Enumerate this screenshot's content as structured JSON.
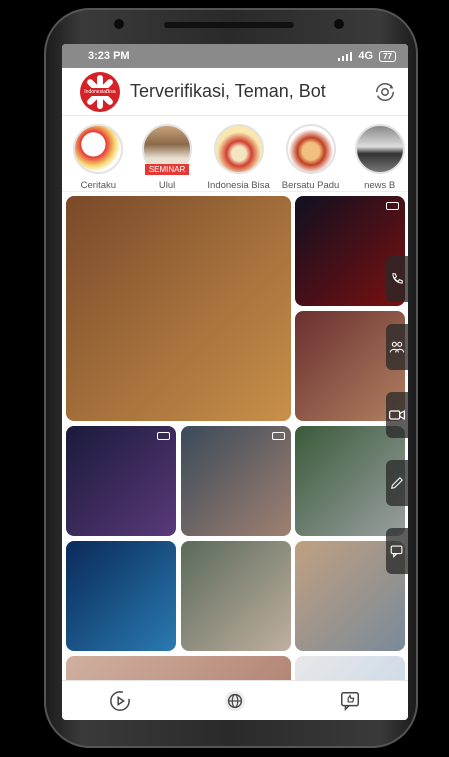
{
  "status": {
    "time": "3:23 PM",
    "network": "4G",
    "battery": "77"
  },
  "header": {
    "logo_text": "IndonesiaBisa",
    "title": "Terverifikasi, Teman, Bot"
  },
  "stories": [
    {
      "label": "Ceritaku",
      "tag": ""
    },
    {
      "label": "Ulul",
      "tag": "SEMINAR"
    },
    {
      "label": "Indonesia Bisa",
      "tag": ""
    },
    {
      "label": "Bersatu Padu",
      "tag": ""
    },
    {
      "label": "news B",
      "tag": ""
    }
  ],
  "tiles": [
    {
      "name": "market-tile",
      "colors": [
        "#7a4a2a",
        "#c8904a"
      ],
      "video": false
    },
    {
      "name": "stage-tile",
      "colors": [
        "#101020",
        "#7a1010"
      ],
      "video": true
    },
    {
      "name": "shop-tile",
      "colors": [
        "#6a3030",
        "#b08060"
      ],
      "video": false
    },
    {
      "name": "band-tile",
      "colors": [
        "#1a1a3a",
        "#5a3a7a"
      ],
      "video": true
    },
    {
      "name": "video-call-tile",
      "colors": [
        "#3a4a5a",
        "#a08070"
      ],
      "video": true
    },
    {
      "name": "waterfall-tile",
      "colors": [
        "#3a5a3a",
        "#9aa0a0"
      ],
      "video": false
    },
    {
      "name": "tech-tile",
      "colors": [
        "#0a2a5a",
        "#2a7ab0"
      ],
      "video": false
    },
    {
      "name": "money-tile",
      "colors": [
        "#5a6a5a",
        "#c0b0a0"
      ],
      "video": false
    },
    {
      "name": "mural-tile",
      "colors": [
        "#c0a080",
        "#7a8a9a"
      ],
      "video": false
    },
    {
      "name": "partial-tile-left",
      "colors": [
        "#d0b0a0",
        "#b08070"
      ],
      "video": false
    },
    {
      "name": "partial-tile-right",
      "colors": [
        "#e8e8e8",
        "#c8d8e8"
      ],
      "video": false
    }
  ],
  "sidebar": [
    "phone-icon",
    "group-icon",
    "video-icon",
    "pencil-icon",
    "chat-icon"
  ],
  "bottom_nav": [
    "play-icon",
    "globe-icon",
    "thumbs-up-icon"
  ]
}
